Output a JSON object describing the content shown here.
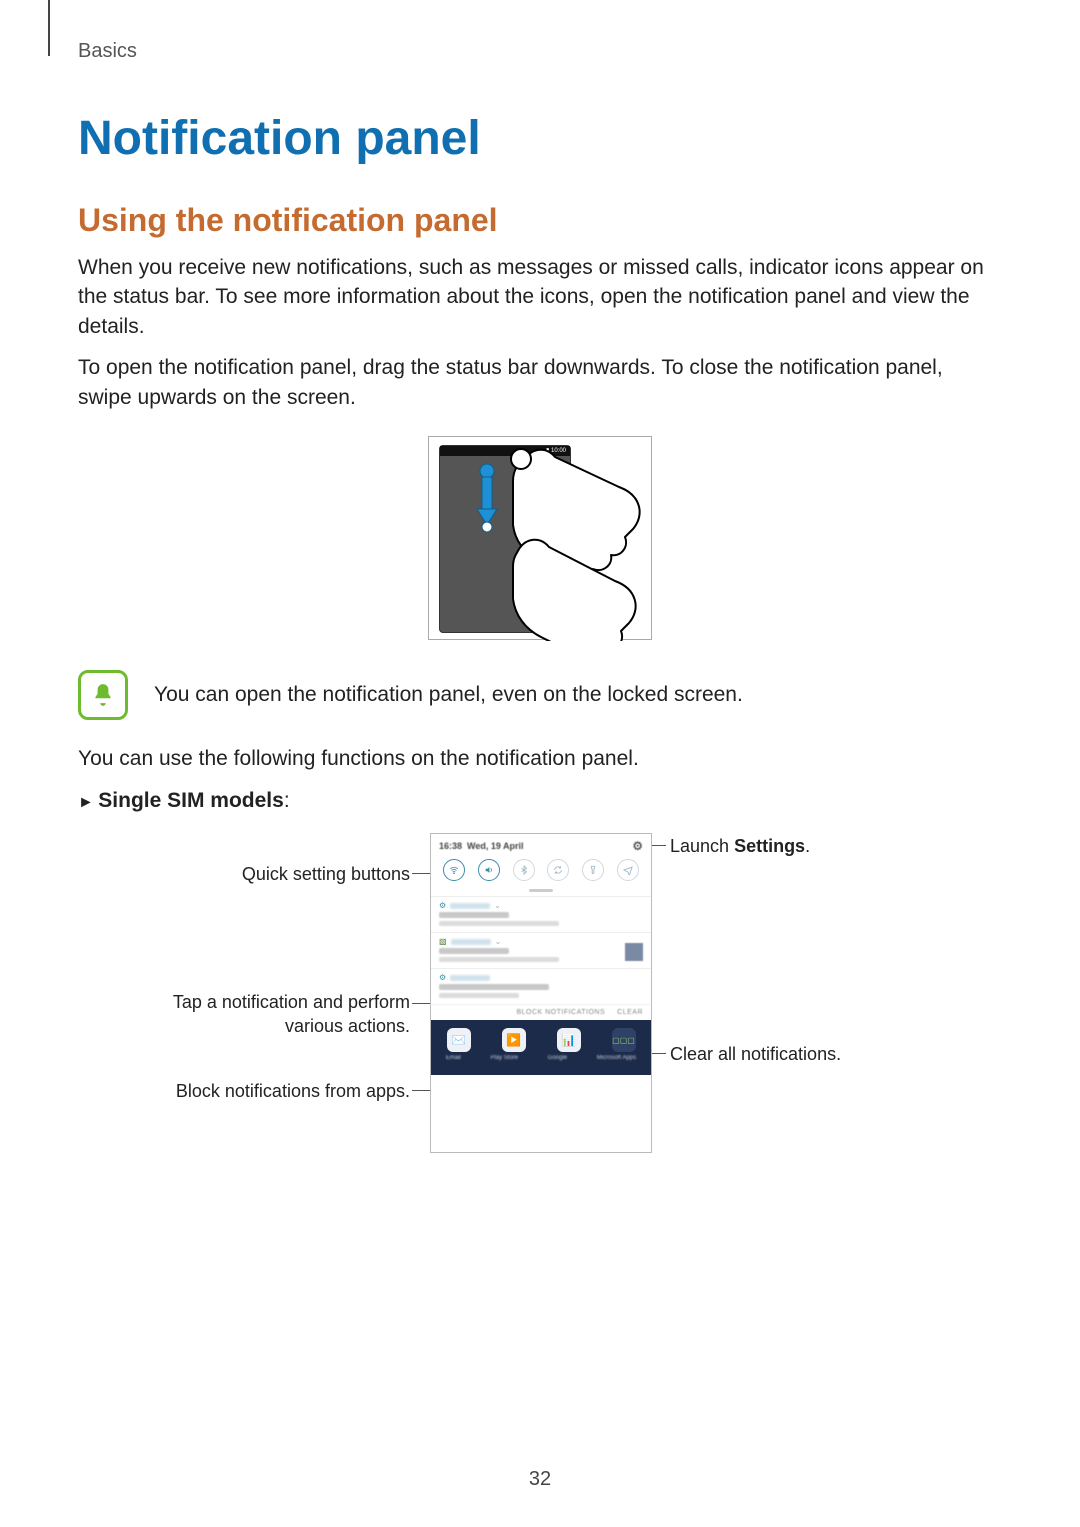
{
  "breadcrumb": "Basics",
  "title": "Notification panel",
  "subtitle": "Using the notification panel",
  "para1": "When you receive new notifications, such as messages or missed calls, indicator icons appear on the status bar. To see more information about the icons, open the notification panel and view the details.",
  "para2": "To open the notification panel, drag the status bar downwards. To close the notification panel, swipe upwards on the screen.",
  "gesture": {
    "status_time": "10:00"
  },
  "note_text": "You can open the notification panel, even on the locked screen.",
  "para3": "You can use the following functions on the notification panel.",
  "sim_heading_prefix": "► ",
  "sim_heading_bold": "Single SIM models",
  "sim_heading_suffix": ":",
  "callouts": {
    "left1": "Quick setting buttons",
    "left2a": "Tap a notification and perform",
    "left2b": "various actions.",
    "left3": "Block notifications from apps.",
    "right1_pre": "Launch ",
    "right1_bold": "Settings",
    "right1_post": ".",
    "right2": "Clear all notifications."
  },
  "panel": {
    "footer_block": "BLOCK NOTIFICATIONS",
    "footer_clear": "CLEAR"
  },
  "page_number": "32"
}
